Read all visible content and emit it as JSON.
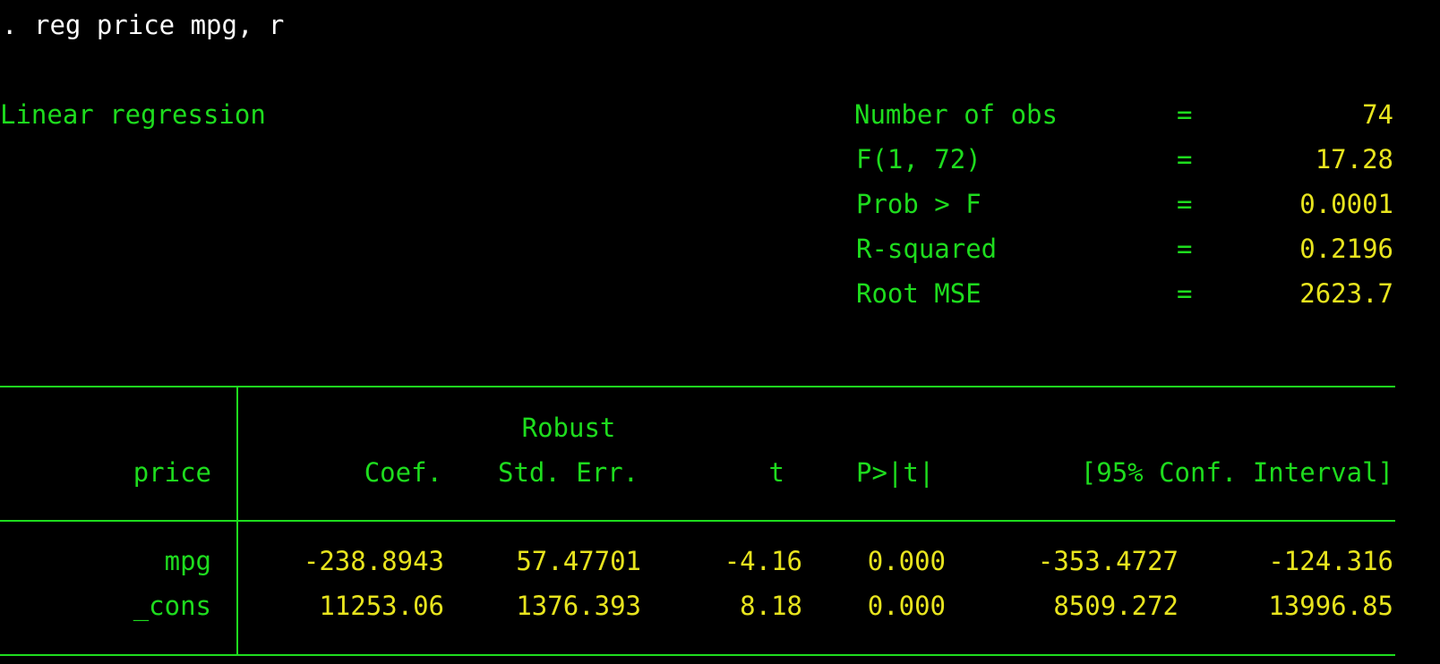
{
  "command": {
    "prompt": ".",
    "text": "reg price mpg, r"
  },
  "model_title": "Linear regression",
  "stats": [
    {
      "label": "Number of obs",
      "eq": "=",
      "value": "74"
    },
    {
      "label": "F(1, 72)",
      "eq": "=",
      "value": "17.28"
    },
    {
      "label": "Prob > F",
      "eq": "=",
      "value": "0.0001"
    },
    {
      "label": "R-squared",
      "eq": "=",
      "value": "0.2196"
    },
    {
      "label": "Root MSE",
      "eq": "=",
      "value": "2623.7"
    }
  ],
  "table": {
    "depvar": "price",
    "header_top": "Robust",
    "columns": {
      "coef": "Coef.",
      "se": "Std. Err.",
      "t": "t",
      "p": "P>|t|",
      "ci": "[95% Conf. Interval]"
    },
    "rows": [
      {
        "var": "mpg",
        "coef": "-238.8943",
        "se": "57.47701",
        "t": "-4.16",
        "p": "0.000",
        "ci_low": "-353.4727",
        "ci_high": "-124.316"
      },
      {
        "var": "_cons",
        "coef": "11253.06",
        "se": "1376.393",
        "t": "8.18",
        "p": "0.000",
        "ci_low": "8509.272",
        "ci_high": "13996.85"
      }
    ]
  },
  "colors": {
    "background": "#000000",
    "command_text": "#ffffff",
    "label_text": "#1edc1e",
    "value_text": "#e8e41e",
    "rules": "#1edc1e"
  }
}
